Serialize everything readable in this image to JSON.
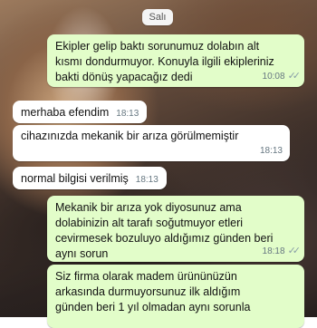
{
  "date_separator": "Salı",
  "messages": [
    {
      "text": "Ekipler gelip baktı sorunumuz dolabın alt\nkısmı dondurmuyor. Konuyla ilgili ekipleriniz\nbakti dönüş yapacağız dedi",
      "time": "10:08",
      "ticks": "✓✓"
    },
    {
      "text": "merhaba efendim",
      "time": "18:13"
    },
    {
      "text": "cihazınızda mekanik bir arıza görülmemiştir",
      "time": "18:13"
    },
    {
      "text": "normal bilgisi verilmiş",
      "time": "18:13"
    },
    {
      "text": "Mekanik bir arıza yok diyosunuz ama\ndolabinizin alt tarafı soğutmuyor etleri\ncevirmesek bozuluyo aldığımız günden beri\naynı sorun",
      "time": "18:18",
      "ticks": "✓✓"
    },
    {
      "text": "Siz firma olarak madem ürününüzün\narkasında durmuyorsunuz ilk aldığım\ngünden beri 1 yıl olmadan aynı sorunla",
      "time": ""
    }
  ],
  "colors": {
    "outgoing": "#e2fdc9",
    "incoming": "#ffffff",
    "read_ticks": "#8aa0a8"
  }
}
